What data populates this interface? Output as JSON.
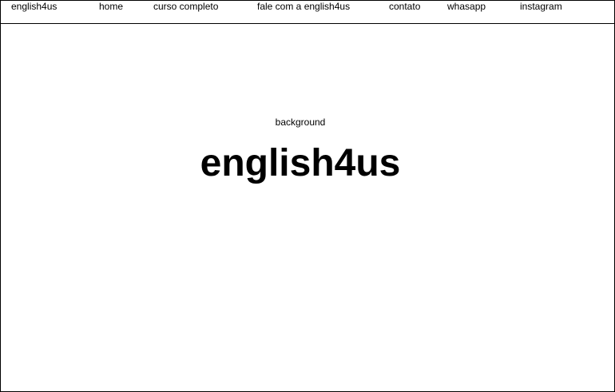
{
  "navbar": {
    "brand": "english4us",
    "links": [
      "home",
      "curso completo",
      "fale com a english4us",
      "contato",
      "whasapp",
      "instagram"
    ]
  },
  "hero": {
    "caption": "background",
    "title": "english4us"
  },
  "colors": {
    "background": "#ffffff",
    "text": "#000000",
    "border": "#000000"
  }
}
